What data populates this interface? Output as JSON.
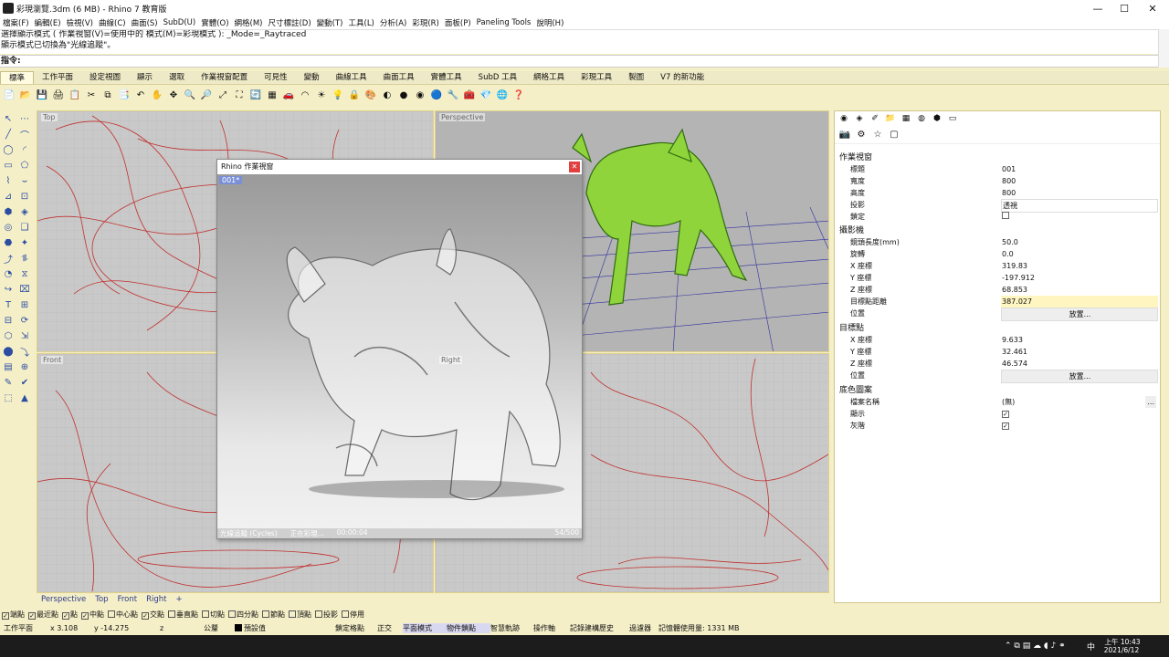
{
  "window": {
    "title": "彩現瀏覽.3dm (6 MB) - Rhino 7 教育版",
    "minimize": "—",
    "maximize": "☐",
    "close": "✕"
  },
  "menu": [
    "檔案(F)",
    "編輯(E)",
    "檢視(V)",
    "曲線(C)",
    "曲面(S)",
    "SubD(U)",
    "實體(O)",
    "網格(M)",
    "尺寸標註(D)",
    "變動(T)",
    "工具(L)",
    "分析(A)",
    "彩現(R)",
    "面板(P)",
    "Paneling Tools",
    "說明(H)"
  ],
  "command": {
    "history_1": "選擇顯示模式 ( 作業視窗(V)=使用中的  模式(M)=彩現模式 ): _Mode=_Raytraced",
    "history_2": "顯示模式已切換為\"光線追蹤\"。",
    "prompt": "指令:"
  },
  "toolbar_tabs": [
    "標準",
    "工作平面",
    "設定視圖",
    "顯示",
    "選取",
    "作業視窗配置",
    "可見性",
    "變動",
    "曲線工具",
    "曲面工具",
    "實體工具",
    "SubD 工具",
    "網格工具",
    "彩現工具",
    "製圖",
    "V7 的新功能"
  ],
  "toolbar_icons": [
    "📄",
    "📂",
    "💾",
    "🖨",
    "📋",
    "✂",
    "⧉",
    "📑",
    "↶",
    "✋",
    "✥",
    "🔍",
    "🔎",
    "⤢",
    "⛶",
    "🔄",
    "▦",
    "🚗",
    "◠",
    "☀",
    "💡",
    "🔒",
    "🎨",
    "◐",
    "●",
    "◉",
    "🔵",
    "🔧",
    "🧰",
    "💎",
    "🌐",
    "❓"
  ],
  "left_tools": [
    "↖",
    "⋯",
    "╱",
    "⌒",
    "◯",
    "◜",
    "▭",
    "⬠",
    "⌇",
    "⌣",
    "⊿",
    "⊡",
    "⬢",
    "◈",
    "◎",
    "❑",
    "⬣",
    "✦",
    "⤴",
    "⥮",
    "◔",
    "⧖",
    "↪",
    "⌧",
    "T",
    "⊞",
    "⊟",
    "⟳",
    "⬡",
    "⇲",
    "⬤",
    "⤵",
    "▤",
    "⊕",
    "✎",
    "✔",
    "⬚",
    "▲"
  ],
  "viewports": {
    "top": "Top",
    "perspective": "Perspective",
    "front": "Front",
    "right": "Right"
  },
  "viewport_tabs": [
    "Perspective",
    "Top",
    "Front",
    "Right",
    "+"
  ],
  "render_window": {
    "title": "Rhino 作業視窗",
    "tag": "001*",
    "status_engine": "光線追蹤 (Cycles)",
    "status_state": "正在彩現...",
    "status_time": "00:00:04",
    "status_passes": "54/500"
  },
  "properties": {
    "sec_viewport": "作業視窗",
    "title_label": "標題",
    "title_value": "001",
    "width_label": "寬度",
    "width_value": "800",
    "height_label": "高度",
    "height_value": "800",
    "projection_label": "投影",
    "projection_value": "透視",
    "lock_label": "鎖定",
    "sec_camera": "攝影機",
    "lens_label": "鏡頭長度(mm)",
    "lens_value": "50.0",
    "rotation_label": "旋轉",
    "rotation_value": "0.0",
    "camx_label": "X 座標",
    "camx_value": "319.83",
    "camy_label": "Y 座標",
    "camy_value": "-197.912",
    "camz_label": "Z 座標",
    "camz_value": "68.853",
    "dist_label": "目標點距離",
    "dist_value": "387.027",
    "pos_label": "位置",
    "place_button": "放置...",
    "sec_target": "目標點",
    "tx_label": "X 座標",
    "tx_value": "9.633",
    "ty_label": "Y 座標",
    "ty_value": "32.461",
    "tz_label": "Z 座標",
    "tz_value": "46.574",
    "tpos_label": "位置",
    "tplace_button": "放置...",
    "sec_wallpaper": "底色圖案",
    "file_label": "檔案名稱",
    "file_value": "(無)",
    "file_browse": "...",
    "show_label": "顯示",
    "gray_label": "灰階"
  },
  "osnap": [
    {
      "label": "端點",
      "checked": true
    },
    {
      "label": "最近點",
      "checked": true
    },
    {
      "label": "點",
      "checked": true
    },
    {
      "label": "中點",
      "checked": true
    },
    {
      "label": "中心點",
      "checked": false
    },
    {
      "label": "交點",
      "checked": true
    },
    {
      "label": "垂直點",
      "checked": false
    },
    {
      "label": "切點",
      "checked": false
    },
    {
      "label": "四分點",
      "checked": false
    },
    {
      "label": "節點",
      "checked": false
    },
    {
      "label": "頂點",
      "checked": false
    },
    {
      "label": "投影",
      "checked": false
    },
    {
      "label": "停用",
      "checked": false
    }
  ],
  "statusbar": {
    "cplane": "工作平面",
    "x": "x 3.108",
    "y": "y -14.275",
    "z": "z",
    "units": "公釐",
    "layer": "預設值",
    "grid_snap": "鎖定格點",
    "ortho": "正交",
    "planar": "平面模式",
    "osnap": "物件鎖點",
    "smarttrack": "智慧軌跡",
    "gumball": "操作軸",
    "history": "記錄建構歷史",
    "filter": "過濾器",
    "memory": "記憶體使用量: 1331 MB"
  },
  "taskbar": {
    "time": "上午 10:43",
    "date": "2021/6/12",
    "ime": "中"
  }
}
